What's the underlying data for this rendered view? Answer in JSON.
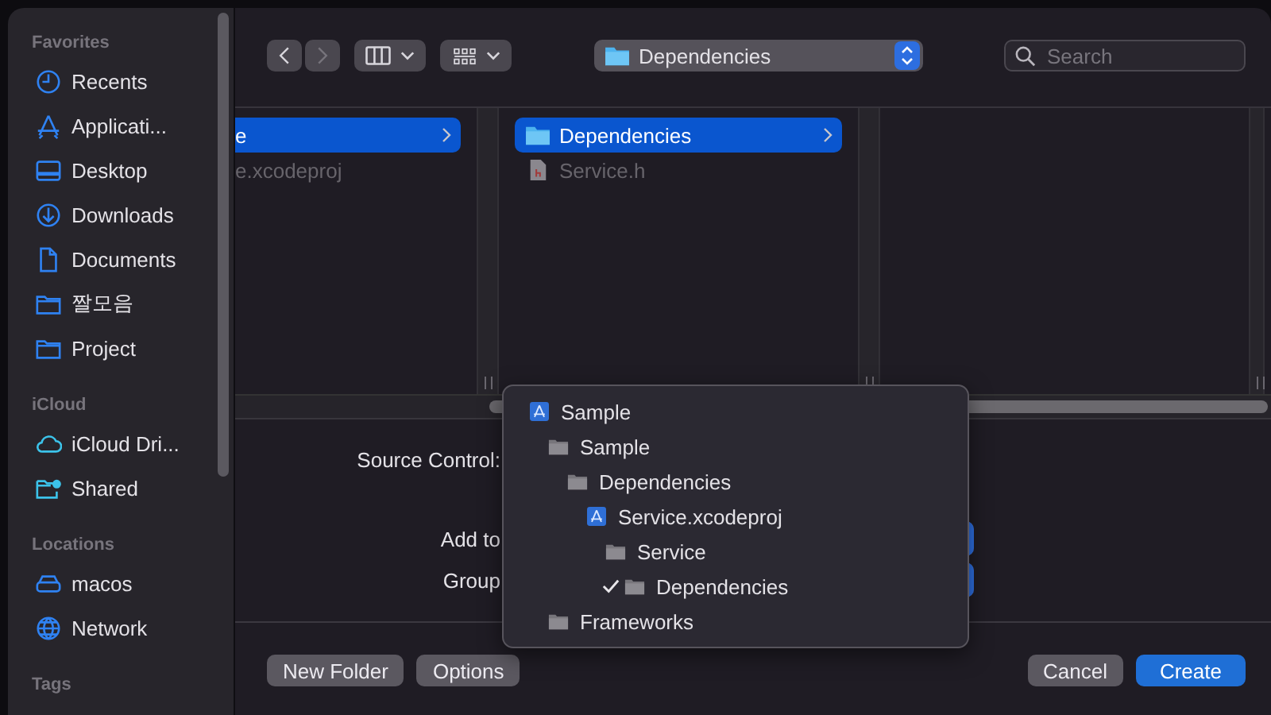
{
  "sidebar": {
    "sections": [
      {
        "title": "Favorites",
        "items": [
          {
            "label": "Recents"
          },
          {
            "label": "Applicati..."
          },
          {
            "label": "Desktop"
          },
          {
            "label": "Downloads"
          },
          {
            "label": "Documents"
          },
          {
            "label": "짤모음"
          },
          {
            "label": "Project"
          }
        ]
      },
      {
        "title": "iCloud",
        "items": [
          {
            "label": "iCloud Dri..."
          },
          {
            "label": "Shared"
          }
        ]
      },
      {
        "title": "Locations",
        "items": [
          {
            "label": "macos"
          },
          {
            "label": "Network"
          }
        ]
      },
      {
        "title": "Tags"
      }
    ]
  },
  "toolbar": {
    "path": "Dependencies",
    "search": {
      "placeholder": "Search"
    }
  },
  "browser": {
    "columns": [
      {
        "items": [
          {
            "name": "e",
            "expandable": true,
            "selected": true,
            "disabled": false
          },
          {
            "name": "e.xcodeproj",
            "expandable": false,
            "selected": false,
            "disabled": true
          }
        ]
      },
      {
        "items": [
          {
            "name": "Dependencies",
            "kind": "folder",
            "expandable": true,
            "selected": true,
            "disabled": false
          },
          {
            "name": "Service.h",
            "kind": "header",
            "expandable": false,
            "selected": false,
            "disabled": true
          }
        ]
      }
    ]
  },
  "form": {
    "fields": [
      {
        "label": "Source Control:",
        "kind": "text"
      },
      {
        "label": "Add to",
        "kind": "popup"
      },
      {
        "label": "Group",
        "kind": "popup"
      }
    ]
  },
  "menu": {
    "items": [
      {
        "label": "Sample",
        "kind": "project",
        "checked": false,
        "children": [
          {
            "label": "Sample",
            "kind": "folder",
            "checked": false,
            "children": [
              {
                "label": "Dependencies",
                "kind": "folder",
                "checked": false,
                "children": [
                  {
                    "label": "Service.xcodeproj",
                    "kind": "project",
                    "checked": false,
                    "children": [
                      {
                        "label": "Service",
                        "kind": "folder",
                        "checked": false,
                        "children": [
                          {
                            "label": "Dependencies",
                            "kind": "folder",
                            "checked": true
                          }
                        ]
                      }
                    ]
                  }
                ]
              }
            ]
          },
          {
            "label": "Frameworks",
            "kind": "folder",
            "checked": false
          }
        ]
      }
    ]
  },
  "buttons": {
    "left": [
      {
        "label": "New Folder",
        "kind": "normal"
      },
      {
        "label": "Options",
        "kind": "normal"
      }
    ],
    "right": [
      {
        "label": "Cancel",
        "kind": "normal"
      },
      {
        "label": "Create",
        "kind": "default"
      }
    ]
  }
}
